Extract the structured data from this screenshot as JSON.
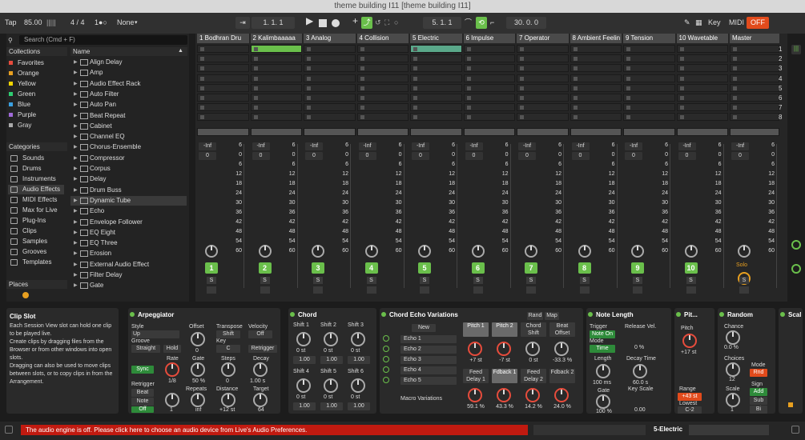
{
  "window": {
    "title": "theme building I11  [theme building I11]"
  },
  "transport": {
    "tap": "Tap",
    "bpm": "85.00",
    "meter": "4 / 4",
    "quantize": "None",
    "position": "1. 1. 1",
    "loop_start": "5. 1. 1",
    "loop_length": "30. 0. 0",
    "key": "Key",
    "midi": "MIDI",
    "off": "OFF"
  },
  "browser": {
    "search_placeholder": "Search (Cmd + F)",
    "collections_label": "Collections",
    "name_label": "Name",
    "categories_label": "Categories",
    "places_label": "Places",
    "collections": [
      {
        "label": "Favorites",
        "color": "#e74c3c"
      },
      {
        "label": "Orange",
        "color": "#e8a020"
      },
      {
        "label": "Yellow",
        "color": "#f1d400"
      },
      {
        "label": "Green",
        "color": "#2ecc71"
      },
      {
        "label": "Blue",
        "color": "#3aa0e0"
      },
      {
        "label": "Purple",
        "color": "#a06ad8"
      },
      {
        "label": "Gray",
        "color": "#aaaaaa"
      }
    ],
    "categories": [
      "Sounds",
      "Drums",
      "Instruments",
      "Audio Effects",
      "MIDI Effects",
      "Max for Live",
      "Plug-Ins",
      "Clips",
      "Samples",
      "Grooves",
      "Templates"
    ],
    "files": [
      "Align Delay",
      "Amp",
      "Audio Effect Rack",
      "Auto Filter",
      "Auto Pan",
      "Beat Repeat",
      "Cabinet",
      "Channel EQ",
      "Chorus-Ensemble",
      "Compressor",
      "Corpus",
      "Delay",
      "Drum Buss",
      "Dynamic Tube",
      "Echo",
      "Envelope Follower",
      "EQ Eight",
      "EQ Three",
      "Erosion",
      "External Audio Effect",
      "Filter Delay",
      "Gate"
    ]
  },
  "session": {
    "tracks": [
      "1 Bodhran Dru",
      "2 Kalimbaaaaa",
      "3 Analog",
      "4 Collision",
      "5 Electric",
      "6 Impulse",
      "7 Operator",
      "8 Ambient Feelin",
      "9 Tension",
      "10 Wavetable",
      "Master"
    ],
    "scenes": [
      "1",
      "2",
      "3",
      "4",
      "5",
      "6",
      "7",
      "8"
    ],
    "scale": [
      "6",
      "0",
      "6",
      "12",
      "18",
      "24",
      "30",
      "36",
      "42",
      "48",
      "54",
      "60"
    ],
    "inf": "-Inf",
    "zero": "0",
    "solo": "Solo",
    "s": "S"
  },
  "info": {
    "title": "Clip Slot",
    "text": "Each Session View slot can hold one clip to be played live.\nCreate clips by dragging files from the Browser or from other windows into open slots.\nDragging can also be used to move clips between slots, or to copy clips in from the Arrangement."
  },
  "arp": {
    "title": "Arpeggiator",
    "style": "Style",
    "style_val": "Up",
    "groove": "Groove",
    "groove_val": "Straight",
    "hold": "Hold",
    "offset": "Offset",
    "offset_val": "0",
    "transpose": "Transpose",
    "transpose_val": "Shift",
    "key": "Key",
    "key_val": "C",
    "velocity": "Velocity",
    "vel_val": "Off",
    "retrigger": "Retrigger",
    "sync": "Sync",
    "rate": "Rate",
    "rate_val": "1/8",
    "gate": "Gate",
    "gate_val": "50 %",
    "steps": "Steps",
    "steps_val": "0",
    "decay": "Decay",
    "decay_val": "1.00 s",
    "retrig2": "Retrigger",
    "beat": "Beat",
    "note": "Note",
    "off": "Off",
    "repeats": "Repeats",
    "rep_val": "inf",
    "distance": "Distance",
    "dist_val": "+12 st",
    "target": "Target",
    "target_val": "64",
    "one": "1"
  },
  "chord": {
    "title": "Chord",
    "shifts": [
      "Shift 1",
      "Shift 2",
      "Shift 3",
      "Shift 4",
      "Shift 5",
      "Shift 6"
    ],
    "st": "0 st",
    "v": "1.00"
  },
  "echo": {
    "title": "Chord Echo Variations",
    "new": "New",
    "items": [
      "Echo 1",
      "Echo 2",
      "Echo 3",
      "Echo 4",
      "Echo 5"
    ],
    "macro": "Macro Variations",
    "rand": "Rand",
    "map": "Map",
    "top": [
      {
        "l": "Pitch 1",
        "v": "+7 st"
      },
      {
        "l": "Pitch 2",
        "v": "-7 st"
      },
      {
        "l": "Chord Shift",
        "v": "0 st"
      },
      {
        "l": "Beat Offset",
        "v": "-33.3 %"
      }
    ],
    "bot": [
      {
        "l": "Feed Delay 1",
        "v": "59.1 %"
      },
      {
        "l": "Fdback 1",
        "v": "43.3 %"
      },
      {
        "l": "Feed Delay 2",
        "v": "14.2 %"
      },
      {
        "l": "Fdback 2",
        "v": "24.0 %"
      }
    ]
  },
  "notelen": {
    "title": "Note Length",
    "trigger": "Trigger",
    "note_on": "Note On",
    "mode": "Mode",
    "time": "Time",
    "release": "Release Vel.",
    "rel_val": "0 %",
    "length": "Length",
    "len_val": "100 ms",
    "decay": "Decay Time",
    "dec_val": "60.0 s",
    "gate": "Gate",
    "gate_val": "100 %",
    "keyscale": "Key Scale",
    "ks_val": "0.00"
  },
  "pitch": {
    "title": "Pit...",
    "pitch": "Pitch",
    "pitch_val": "+17 st",
    "range": "Range",
    "range_val": "+43 st",
    "lowest": "Lowest",
    "low_val": "C-2"
  },
  "random": {
    "title": "Random",
    "chance": "Chance",
    "ch_val": "0.0 %",
    "choices": "Choices",
    "choices_val": "12",
    "mode": "Mode",
    "mode_val": "Rnd",
    "scale": "Scale",
    "scale_val": "1",
    "sign": "Sign",
    "add": "Add",
    "sub": "Sub",
    "bi": "Bi"
  },
  "scale_dev": {
    "title": "Scal"
  },
  "status": {
    "error": "The audio engine is off. Please click here to choose an audio device from Live's Audio Preferences.",
    "track": "5-Electric"
  }
}
